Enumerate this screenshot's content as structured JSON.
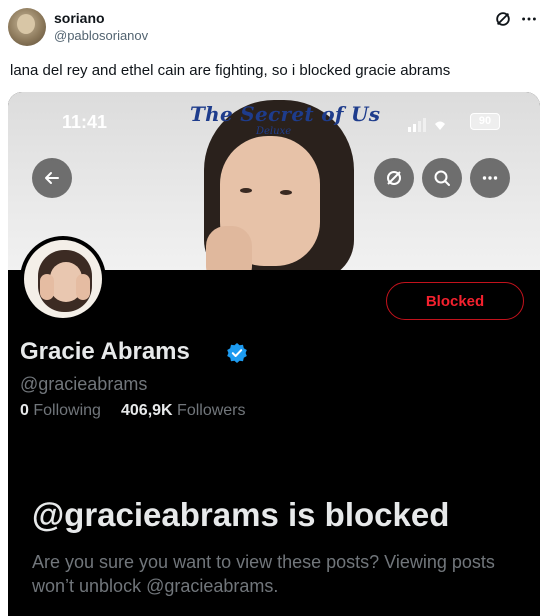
{
  "tweet": {
    "display_name": "soriano",
    "handle": "@pablosorianov",
    "text": "lana del rey and ethel cain are fighting, so i blocked gracie abrams",
    "icons": [
      "grok-icon",
      "more-icon"
    ]
  },
  "screenshot": {
    "status_bar": {
      "time": "11:41",
      "battery": "90"
    },
    "banner": {
      "album_title": "The Secret of Us",
      "album_subtitle": "Deluxe"
    },
    "profile": {
      "name": "Gracie Abrams",
      "handle": "@gracieabrams",
      "following_count": "0",
      "following_label": "Following",
      "followers_count": "406,9K",
      "followers_label": "Followers",
      "blocked_button": "Blocked",
      "verified_color": "#1d9bf0"
    },
    "blocked_notice": {
      "title": "@gracieabrams is blocked",
      "description": "Are you sure you want to view these posts? Viewing posts won’t unblock @gracieabrams."
    },
    "colors": {
      "blocked_red": "#f4212e",
      "background": "#000000"
    }
  }
}
